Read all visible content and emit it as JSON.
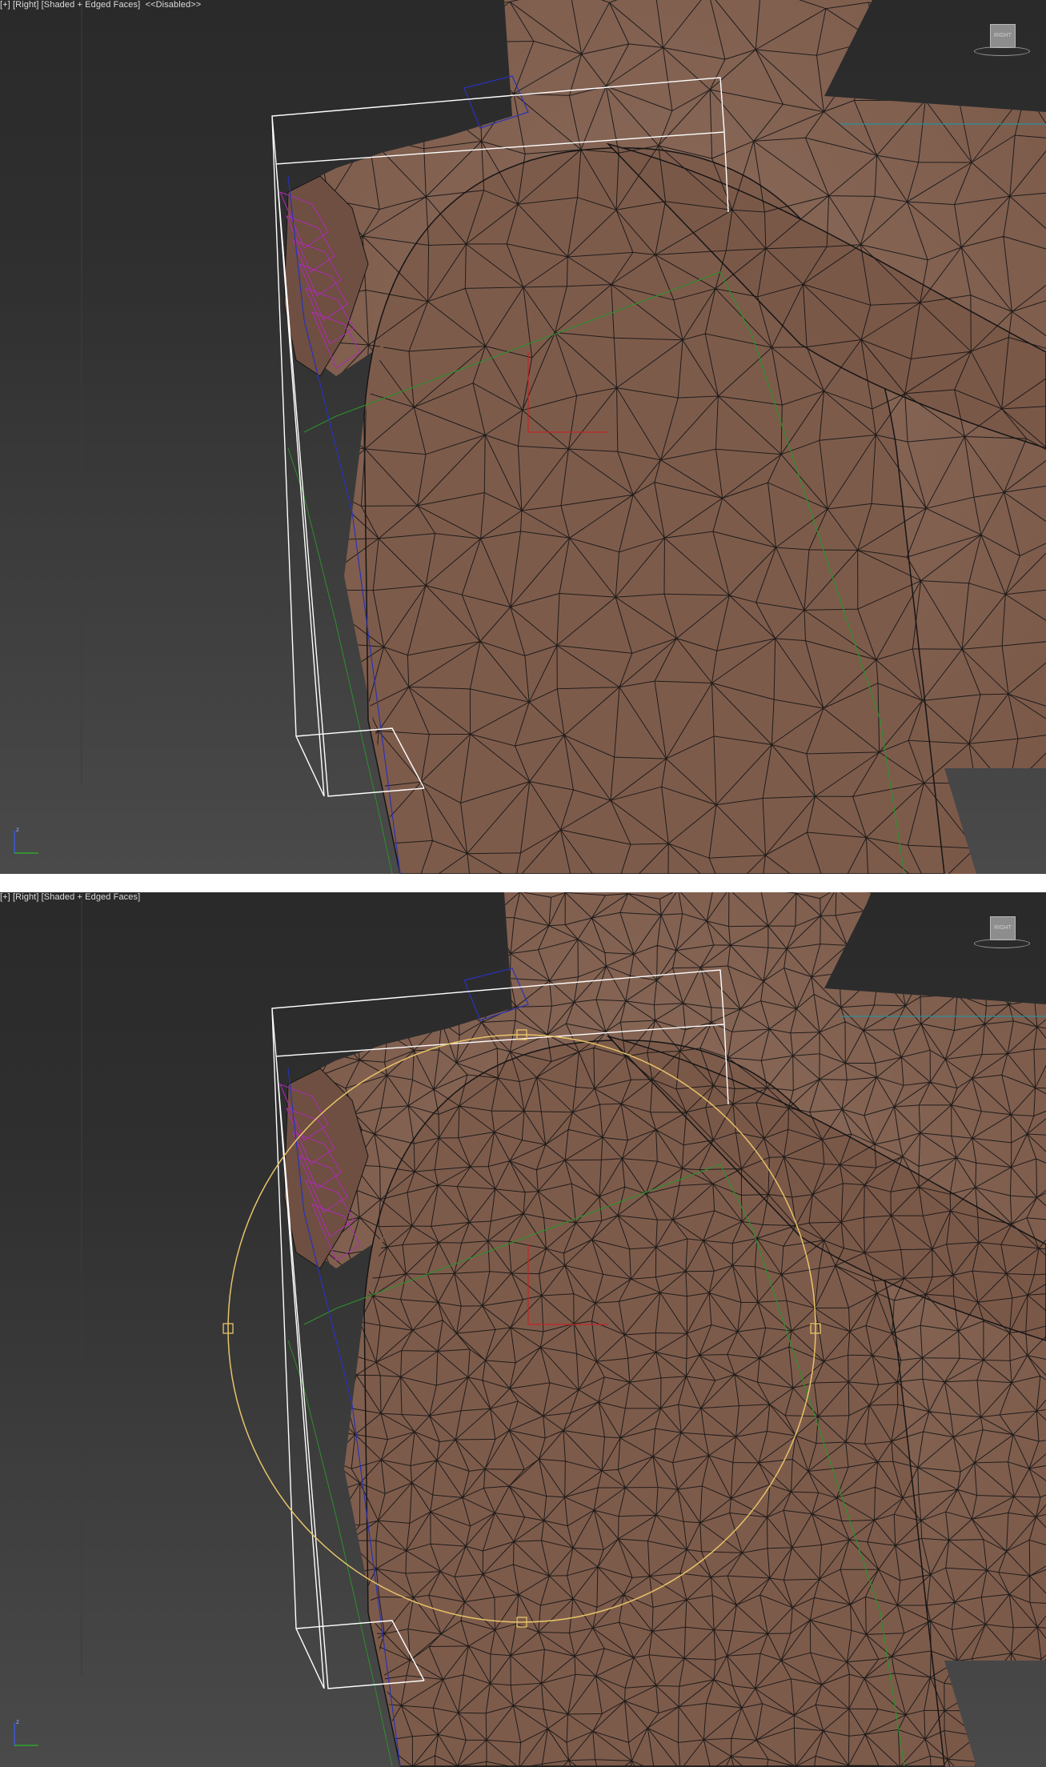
{
  "viewports": [
    {
      "id": "top",
      "label": {
        "plus": "[+]",
        "view": "[Right]",
        "shading": "[Shaded + Edged Faces]",
        "status": "<<Disabled>>"
      },
      "viewcube_label": "RIGHT",
      "gizmo": false
    },
    {
      "id": "bottom",
      "label": {
        "plus": "[+]",
        "view": "[Right]",
        "shading": "[Shaded + Edged Faces]",
        "status": ""
      },
      "viewcube_label": "RIGHT",
      "gizmo": true
    }
  ],
  "axis_tripod": {
    "z_label": "z"
  },
  "colors": {
    "skin": "#7a5848",
    "wire": "#151515",
    "bounding_box": "#ffffff",
    "gizmo": "#e8c468",
    "bone_green": "#2d8f2d",
    "bone_blue": "#2a32b8",
    "bone_cyan": "#2a8f9a",
    "magenta": "#b02ab8"
  }
}
